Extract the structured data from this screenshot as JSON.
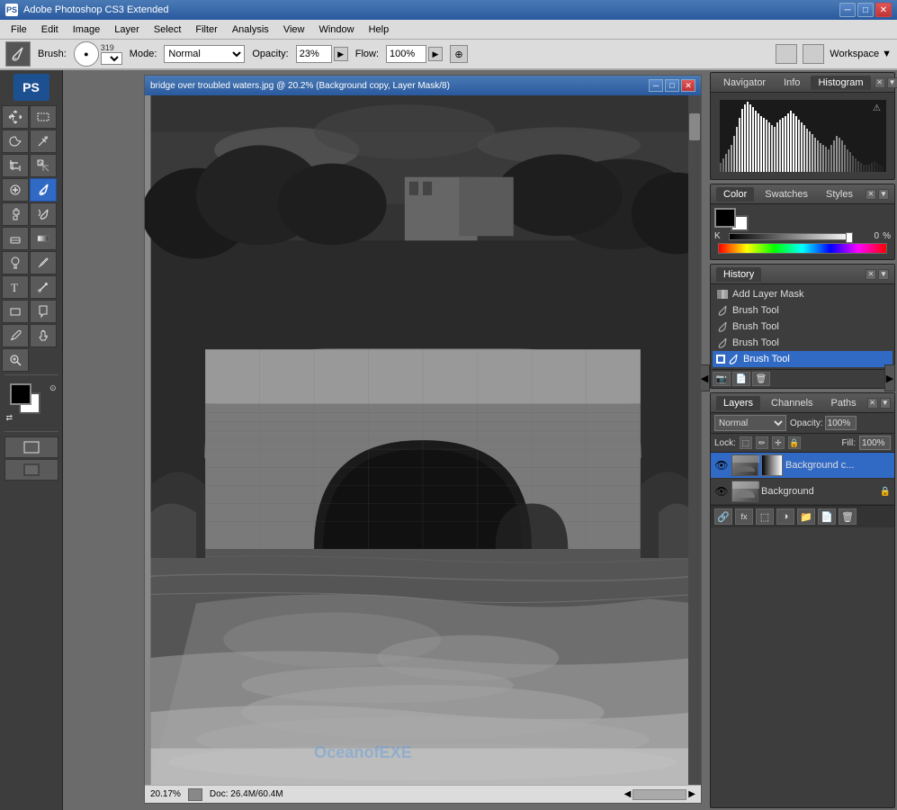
{
  "app": {
    "title": "Adobe Photoshop CS3 Extended",
    "icon": "PS"
  },
  "menu": {
    "items": [
      "File",
      "Edit",
      "Image",
      "Layer",
      "Select",
      "Filter",
      "Analysis",
      "View",
      "Window",
      "Help"
    ]
  },
  "options_bar": {
    "brush_label": "Brush:",
    "brush_size": "319",
    "mode_label": "Mode:",
    "mode_value": "Normal",
    "opacity_label": "Opacity:",
    "opacity_value": "23%",
    "flow_label": "Flow:",
    "flow_value": "100%",
    "workspace_label": "Workspace"
  },
  "document": {
    "title": "bridge over troubled waters.jpg @ 20.2% (Background copy, Layer Mask/8)",
    "zoom": "20.17%",
    "doc_size": "Doc: 26.4M/60.4M"
  },
  "panels": {
    "histogram": {
      "tabs": [
        "Navigator",
        "Info",
        "Histogram"
      ]
    },
    "color": {
      "tabs": [
        "Color",
        "Swatches",
        "Styles"
      ],
      "k_label": "K",
      "k_value": "0",
      "percent": "%"
    },
    "history": {
      "tabs": [
        "History"
      ],
      "items": [
        {
          "label": "Add Layer Mask",
          "icon": "mask"
        },
        {
          "label": "Brush Tool",
          "icon": "brush"
        },
        {
          "label": "Brush Tool",
          "icon": "brush"
        },
        {
          "label": "Brush Tool",
          "icon": "brush"
        },
        {
          "label": "Brush Tool",
          "icon": "brush",
          "active": true
        }
      ]
    },
    "layers": {
      "tabs": [
        "Layers",
        "Channels",
        "Paths"
      ],
      "blend_mode": "Normal",
      "opacity_label": "Opacity:",
      "opacity_value": "100%",
      "fill_label": "Fill:",
      "fill_value": "100%",
      "lock_label": "Lock:",
      "layers": [
        {
          "name": "Background c...",
          "active": true,
          "visible": true,
          "has_mask": true,
          "locked": false
        },
        {
          "name": "Background",
          "active": false,
          "visible": true,
          "has_mask": false,
          "locked": true
        }
      ]
    }
  },
  "toolbar": {
    "tools": [
      {
        "icon": "↖",
        "name": "move-tool"
      },
      {
        "icon": "⬚",
        "name": "marquee-tool"
      },
      {
        "icon": "✂",
        "name": "lasso-tool"
      },
      {
        "icon": "⌖",
        "name": "magic-wand"
      },
      {
        "icon": "✂",
        "name": "crop-tool"
      },
      {
        "icon": "⊘",
        "name": "slice-tool"
      },
      {
        "icon": "⊕",
        "name": "healing-brush"
      },
      {
        "icon": "✏",
        "name": "brush-tool",
        "active": true
      },
      {
        "icon": "S",
        "name": "stamp-tool"
      },
      {
        "icon": "↺",
        "name": "history-brush"
      },
      {
        "icon": "◉",
        "name": "eraser-tool"
      },
      {
        "icon": "▓",
        "name": "gradient-tool"
      },
      {
        "icon": "◈",
        "name": "dodge-tool"
      },
      {
        "icon": "✒",
        "name": "pen-tool"
      },
      {
        "icon": "T",
        "name": "type-tool"
      },
      {
        "icon": "↗",
        "name": "path-select"
      },
      {
        "icon": "□",
        "name": "shape-tool"
      },
      {
        "icon": "☞",
        "name": "notes-tool"
      },
      {
        "icon": "⊕",
        "name": "eyedropper"
      },
      {
        "icon": "✋",
        "name": "hand-tool"
      },
      {
        "icon": "🔍",
        "name": "zoom-tool"
      }
    ]
  },
  "watermark": "OceanofEXE"
}
